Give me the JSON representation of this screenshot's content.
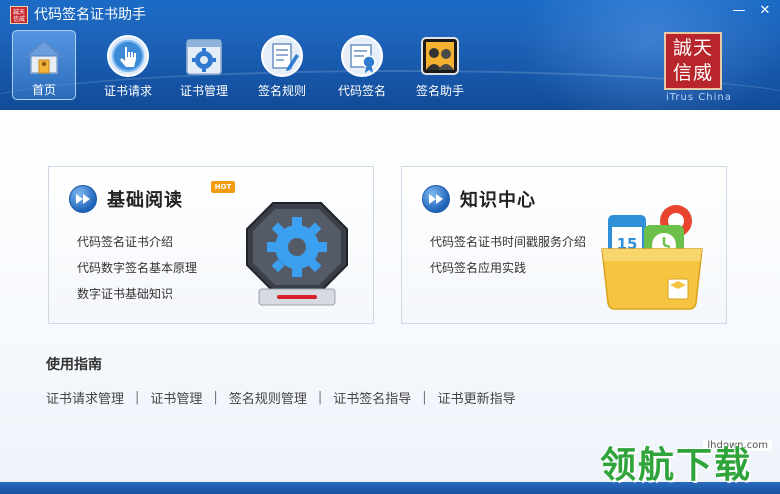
{
  "window": {
    "title": "代码签名证书助手",
    "controls": {
      "minimize": "—",
      "close": "✕"
    }
  },
  "toolbar": {
    "items": [
      {
        "label": "首页",
        "icon": "home-icon",
        "active": true
      },
      {
        "label": "证书请求",
        "icon": "hand-pointer-icon"
      },
      {
        "label": "证书管理",
        "icon": "gear-folder-icon"
      },
      {
        "label": "签名规则",
        "icon": "document-pen-icon"
      },
      {
        "label": "代码签名",
        "icon": "certificate-icon"
      },
      {
        "label": "签名助手",
        "icon": "assistant-icon"
      }
    ]
  },
  "brand": {
    "seal_line1": "誠天",
    "seal_line2": "信威",
    "app_icon_text": "誠天信威",
    "sub_text": "iTrus China"
  },
  "cards": [
    {
      "title": "基础阅读",
      "badge": "HOT",
      "links": [
        "代码签名证书介绍",
        "代码数字签名基本原理",
        "数字证书基础知识"
      ]
    },
    {
      "title": "知识中心",
      "links": [
        "代码签名证书时间戳服务介绍",
        "代码签名应用实践"
      ]
    }
  ],
  "guide": {
    "title": "使用指南",
    "links": [
      "证书请求管理",
      "证书管理",
      "签名规则管理",
      "证书签名指导",
      "证书更新指导"
    ],
    "separator": "|"
  },
  "watermark": {
    "text": "领航下载",
    "url": "lhdown.com"
  },
  "colors": {
    "header": "#1d63b9",
    "seal": "#b8262b",
    "accent": "#1f63b8",
    "hot": "#f39c12",
    "watermark": "#2fa43a"
  }
}
